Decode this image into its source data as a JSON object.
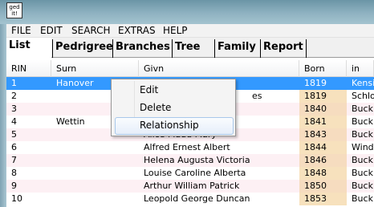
{
  "app": {
    "icon_text": "ged it!"
  },
  "menu": [
    "FILE",
    "EDIT",
    "SEARCH",
    "EXTRAS",
    "HELP"
  ],
  "tabs": [
    {
      "label": "List",
      "active": true
    },
    {
      "label": "Pedrigree"
    },
    {
      "label": "Branches"
    },
    {
      "label": "Tree"
    },
    {
      "label": "Family"
    },
    {
      "label": "Report"
    }
  ],
  "table": {
    "columns": [
      "RIN",
      "Surn",
      "Givn",
      "Born",
      "in"
    ],
    "rows": [
      {
        "rin": "1",
        "surn": "Hanover",
        "givn": "",
        "born": "1819",
        "in": "Kensi",
        "selected": true
      },
      {
        "rin": "2",
        "surn": "",
        "givn": "es",
        "born": "1819",
        "in": "Schlo"
      },
      {
        "rin": "3",
        "surn": "",
        "givn": "",
        "born": "1840",
        "in": "Buck"
      },
      {
        "rin": "4",
        "surn": "Wettin",
        "givn": "",
        "born": "1841",
        "in": "Buck"
      },
      {
        "rin": "5",
        "surn": "",
        "givn": "Alice Maud Mary",
        "born": "1843",
        "in": "Buck"
      },
      {
        "rin": "6",
        "surn": "",
        "givn": "Alfred Ernest Albert",
        "born": "1844",
        "in": "Wind"
      },
      {
        "rin": "7",
        "surn": "",
        "givn": "Helena Augusta Victoria",
        "born": "1846",
        "in": "Buck"
      },
      {
        "rin": "8",
        "surn": "",
        "givn": "Louise Caroline Alberta",
        "born": "1848",
        "in": "Buck"
      },
      {
        "rin": "9",
        "surn": "",
        "givn": "Arthur William Patrick",
        "born": "1850",
        "in": "Buck"
      },
      {
        "rin": "10",
        "surn": "",
        "givn": "Leopold George Duncan",
        "born": "1853",
        "in": "Buck"
      }
    ]
  },
  "context_menu": {
    "items": [
      "Edit",
      "Delete",
      "Relationship"
    ],
    "hover_index": 2
  },
  "colors": {
    "selection": "#3399ff",
    "born_column": "#f7e1bd",
    "row_alt": "#fdf0f4",
    "titlebar": "#8fb2c1"
  }
}
